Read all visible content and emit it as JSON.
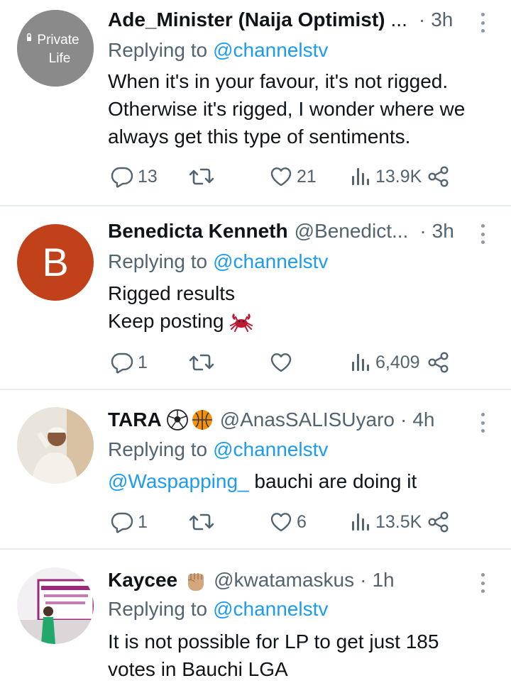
{
  "tweets": [
    {
      "name": "Ade_Minister (Naija Optimist)",
      "name_truncation": "...",
      "handle": "",
      "separator": "·",
      "time": "3h",
      "avatar_text_line1": "Private",
      "avatar_text_line2": "Life",
      "replying_prefix": "Replying to",
      "replying_to": "@channelstv",
      "text_lines": [
        "When it's in your favour, it's not rigged.",
        "Otherwise it's rigged, I wonder where we",
        "always get this type of sentiments."
      ],
      "replies": "13",
      "retweets": "",
      "likes": "21",
      "views": "13.9K"
    },
    {
      "name": "Benedicta Kenneth",
      "handle": "@Benedict...",
      "separator": "·",
      "time": "3h",
      "avatar_letter": "B",
      "avatar_color": "#c1411a",
      "replying_prefix": "Replying to",
      "replying_to": "@channelstv",
      "text_lines": [
        "Rigged results",
        "Keep posting"
      ],
      "text_emoji": "crab-emoji",
      "replies": "1",
      "retweets": "",
      "likes": "",
      "views": "6,409"
    },
    {
      "name": "TARA",
      "name_emojis": [
        "soccer-ball-emoji",
        "basketball-emoji"
      ],
      "handle": "@AnasSALISUyaro",
      "separator": "·",
      "time": "4h",
      "replying_prefix": "Replying to",
      "replying_to": "@channelstv",
      "text_mention": "@Waspapping_",
      "text_rest": "bauchi are doing it",
      "replies": "1",
      "retweets": "",
      "likes": "6",
      "views": "13.5K"
    },
    {
      "name": "Kaycee",
      "name_emojis": [
        "raised-fist-emoji"
      ],
      "handle": "@kwatamaskus",
      "separator": "·",
      "time": "1h",
      "replying_prefix": "Replying to",
      "replying_to": "@channelstv",
      "text_lines": [
        "It is not possible for LP to get just 185",
        "votes in Bauchi LGA"
      ]
    }
  ],
  "colors": {
    "link": "#1d9bf0",
    "secondary_text": "#536471",
    "primary_text": "#0f1419",
    "divider": "#e6ecf0"
  },
  "icons": {
    "reply": "reply-icon",
    "retweet": "retweet-icon",
    "like": "like-icon",
    "views": "views-icon",
    "share": "share-icon",
    "more": "more-options-icon"
  }
}
